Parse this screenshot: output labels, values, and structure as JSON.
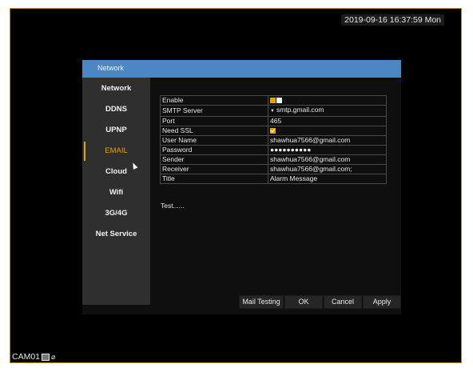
{
  "status": {
    "datetime": "2019-09-16 16:37:59 Mon",
    "camera_label": "CAM01"
  },
  "dialog": {
    "title": "Network",
    "sidebar": [
      {
        "label": "Network"
      },
      {
        "label": "DDNS"
      },
      {
        "label": "UPNP"
      },
      {
        "label": "EMAIL",
        "active": true
      },
      {
        "label": "Cloud"
      },
      {
        "label": "Wifi"
      },
      {
        "label": "3G/4G"
      },
      {
        "label": "Net Service"
      }
    ],
    "email": {
      "enable_label": "Enable",
      "smtp_label": "SMTP Server",
      "smtp_value": "smtp.gmail.com",
      "port_label": "Port",
      "port_value": "465",
      "ssl_label": "Need SSL",
      "username_label": "User Name",
      "username_value": "shawhua7566@gmail.com",
      "password_label": "Password",
      "password_value": "●●●●●●●●●●",
      "sender_label": "Sender",
      "sender_value": "shawhua7566@gmail.com",
      "receiver_label": "Receiver",
      "receiver_value": "shawhua7566@gmail.com;",
      "title_label": "Title",
      "title_value": "Alarm Message",
      "test_status": "Test......"
    },
    "buttons": {
      "mail_testing": "Mail Testing",
      "ok": "OK",
      "cancel": "Cancel",
      "apply": "Apply"
    }
  },
  "colors": {
    "titlebar": "#4d87c3",
    "accent": "#e1a400",
    "sidebar_bg": "#2f2f2f",
    "dialog_bg": "#0f0f0f"
  }
}
